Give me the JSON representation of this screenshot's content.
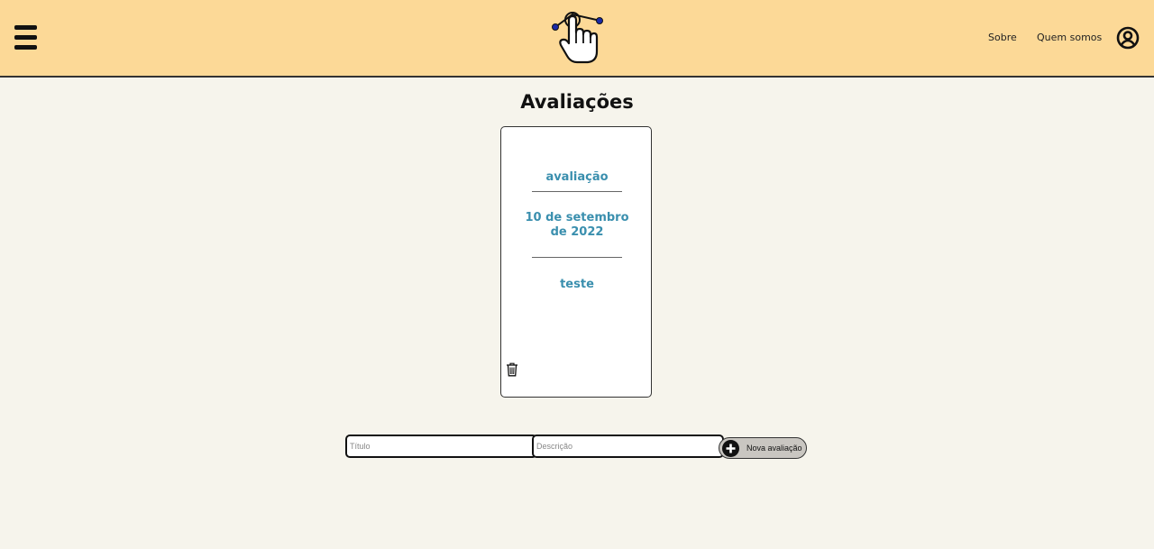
{
  "header": {
    "nav": {
      "sobre": "Sobre",
      "quem_somos": "Quem somos"
    },
    "icons": {
      "menu": "hamburger-menu-icon",
      "logo": "pointing-hand-logo",
      "profile": "user-circle-icon"
    },
    "colors": {
      "background": "#fcd997",
      "logo_dots": "#1a2aa8"
    }
  },
  "main": {
    "title": "Avaliações",
    "cards": [
      {
        "title": "avaliação",
        "date": "10 de setembro de 2022",
        "description": "teste",
        "delete_icon": "trash-icon"
      }
    ],
    "colors": {
      "card_text": "#3a8fae",
      "page_background": "#f6f4ec"
    }
  },
  "form": {
    "titulo_placeholder": "Título",
    "descricao_placeholder": "Descrição",
    "titulo_value": "",
    "descricao_value": "",
    "new_button_label": "Nova avaliação",
    "new_button_icon": "plus-circle-icon"
  }
}
